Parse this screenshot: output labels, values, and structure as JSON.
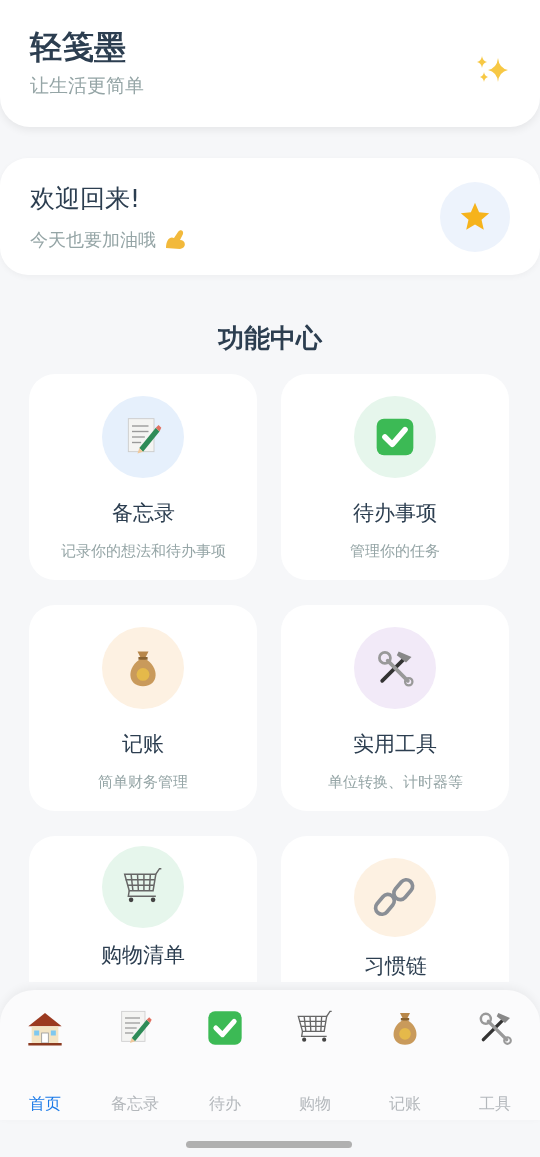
{
  "header": {
    "title": "轻笺墨",
    "subtitle": "让生活更简单"
  },
  "welcome": {
    "title": "欢迎回来!",
    "subtitle": "今天也要加油哦"
  },
  "section_title": "功能中心",
  "features": [
    {
      "kind": "memo",
      "color": "#e6f0fc",
      "title": "备忘录",
      "subtitle": "记录你的想法和待办事项"
    },
    {
      "kind": "todo",
      "color": "#e6f6ec",
      "title": "待办事项",
      "subtitle": "管理你的任务"
    },
    {
      "kind": "money",
      "color": "#fdf1e2",
      "title": "记账",
      "subtitle": "简单财务管理"
    },
    {
      "kind": "tools",
      "color": "#f2eaf8",
      "title": "实用工具",
      "subtitle": "单位转换、计时器等"
    },
    {
      "kind": "cart",
      "color": "#e6f6ec",
      "title": "购物清单"
    },
    {
      "kind": "link",
      "color": "#fdf1e2",
      "title": "习惯链"
    }
  ],
  "tab_bar": [
    {
      "kind": "home",
      "label": "首页",
      "selected": true
    },
    {
      "kind": "memo",
      "label": "备忘录",
      "selected": false
    },
    {
      "kind": "todo",
      "label": "待办",
      "selected": false
    },
    {
      "kind": "cart",
      "label": "购物",
      "selected": false
    },
    {
      "kind": "money",
      "label": "记账",
      "selected": false
    },
    {
      "kind": "tools",
      "label": "工具",
      "selected": false
    }
  ]
}
